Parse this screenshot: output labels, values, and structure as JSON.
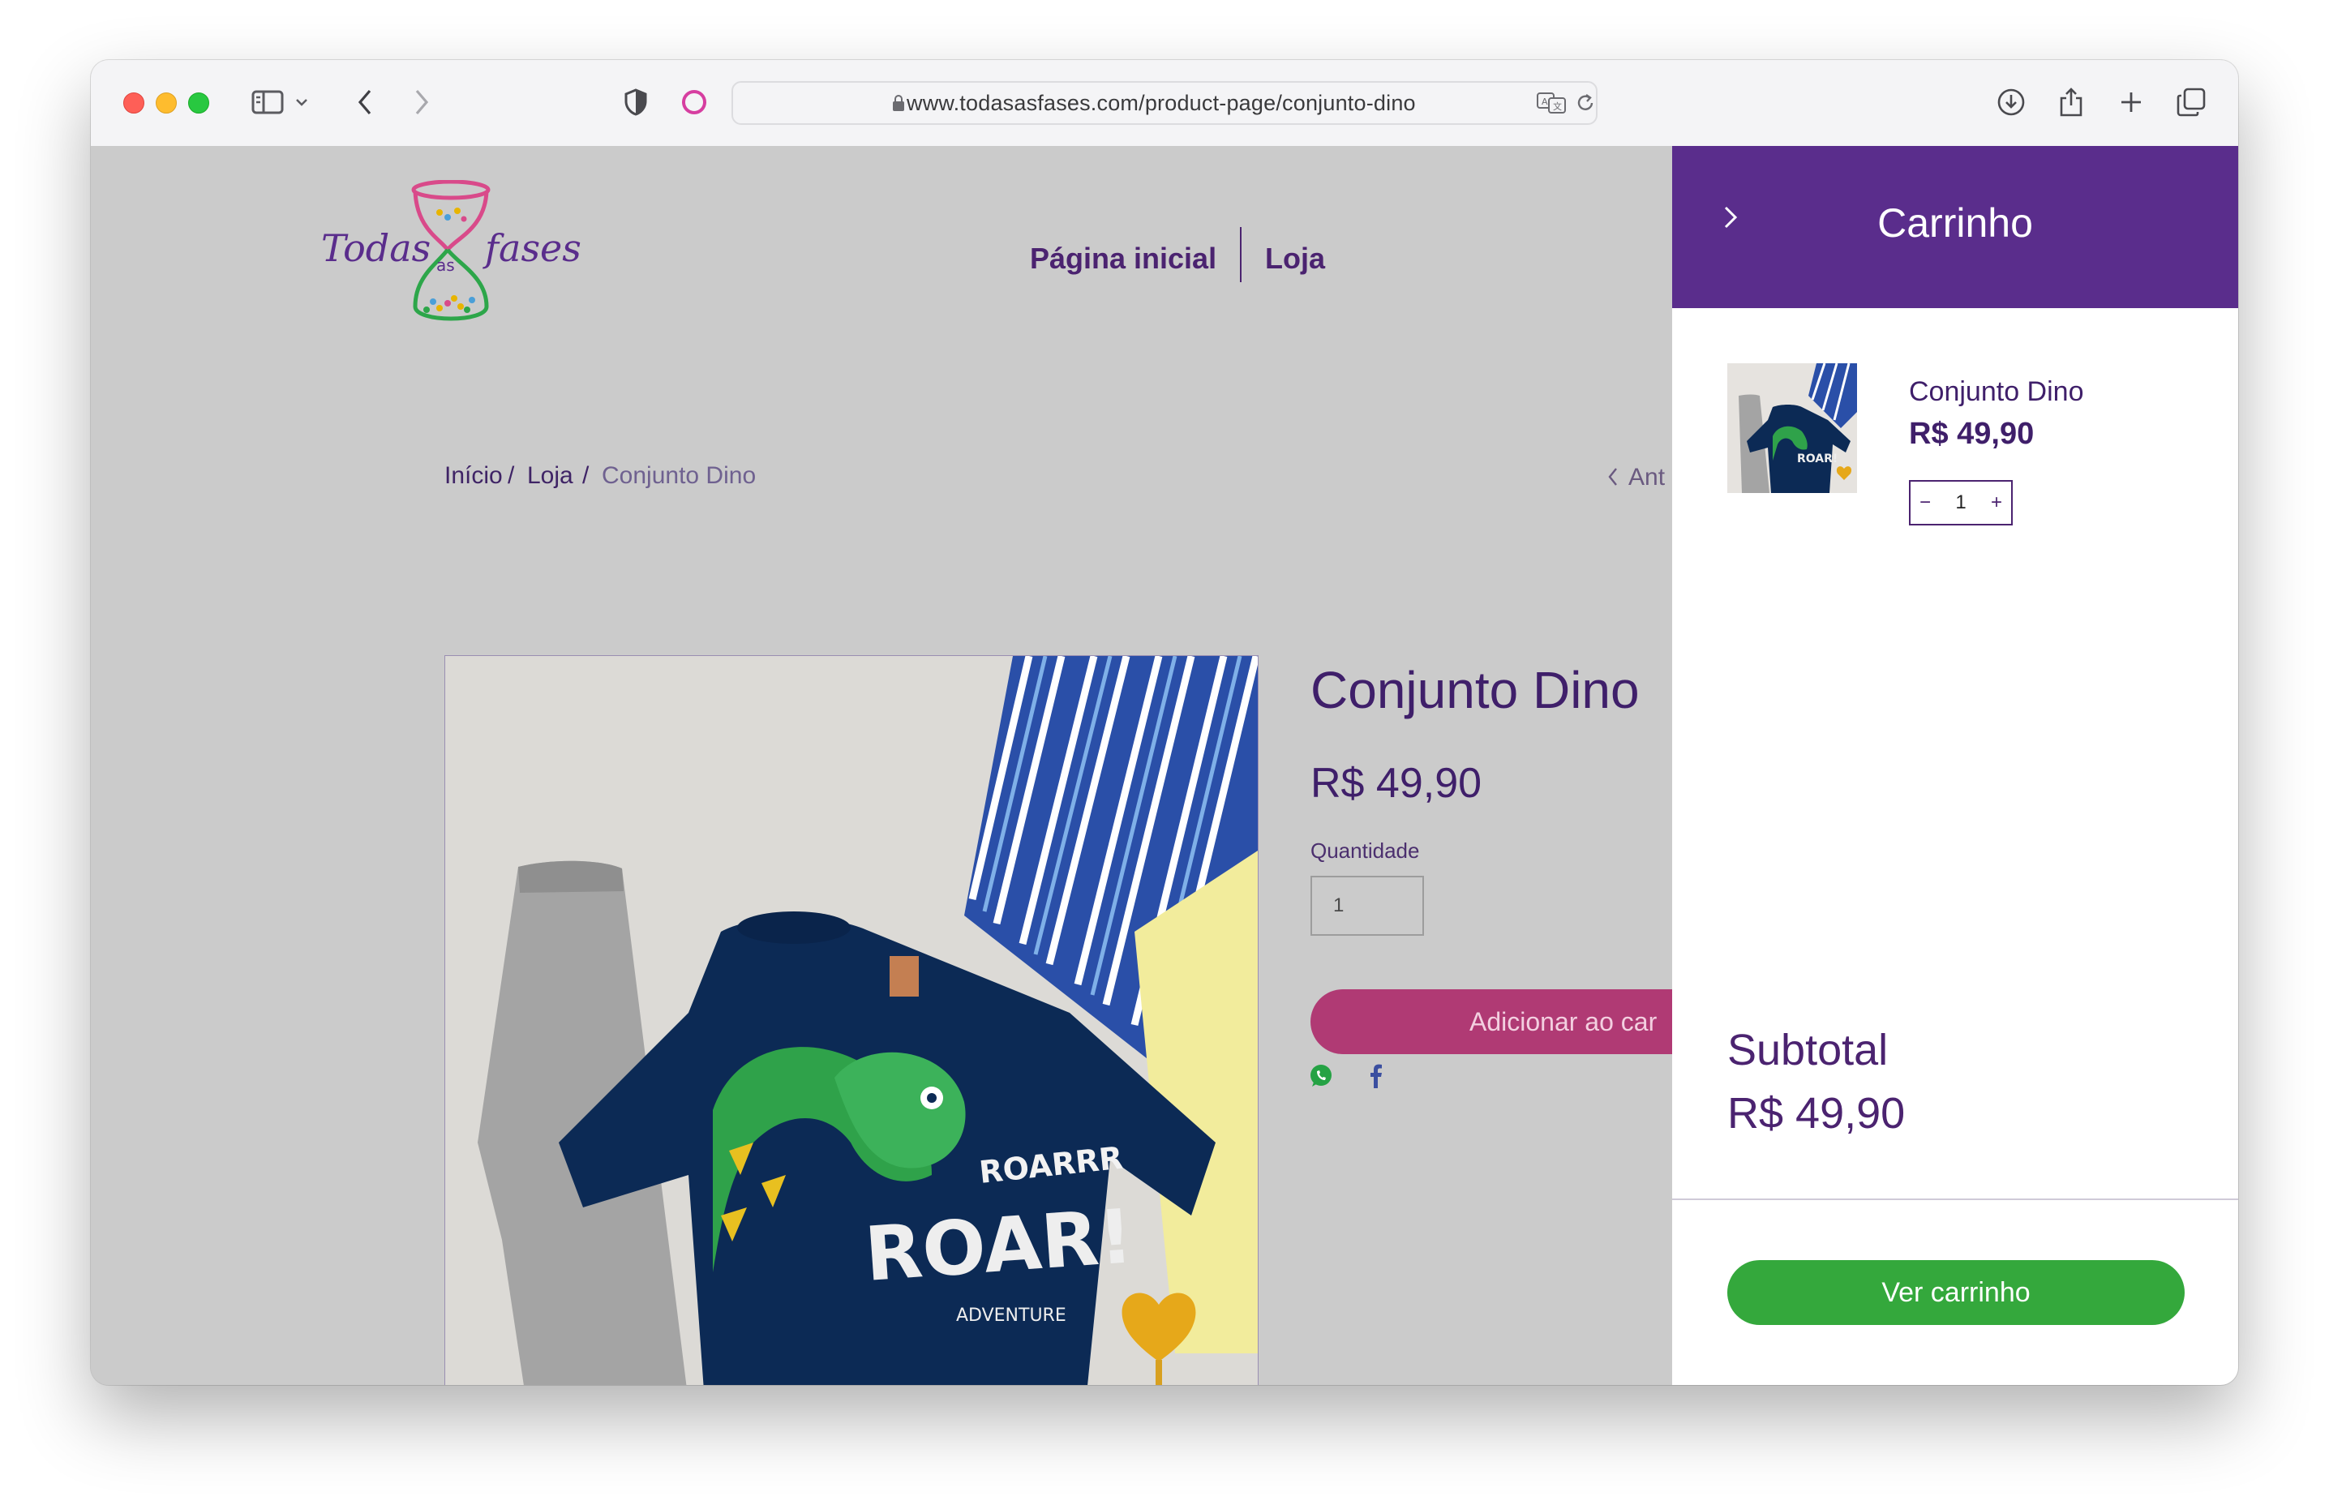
{
  "browser": {
    "url": "www.todasasfases.com/product-page/conjunto-dino"
  },
  "site": {
    "logo_text": "Todas as fases",
    "nav": [
      "Página inicial",
      "Loja"
    ]
  },
  "breadcrumb": {
    "home": "Início",
    "sep1": "/",
    "shop": "Loja",
    "sep2": "/",
    "current": "Conjunto Dino"
  },
  "pager": {
    "prev": "Ant"
  },
  "product": {
    "title": "Conjunto Dino",
    "price": "R$ 49,90",
    "quantity_label": "Quantidade",
    "quantity": "1",
    "add_to_cart": "Adicionar ao car",
    "image_text": [
      "ROARRR",
      "ROAR!",
      "ADVENTURE"
    ]
  },
  "cart": {
    "title": "Carrinho",
    "item": {
      "name": "Conjunto Dino",
      "price": "R$ 49,90",
      "quantity": "1",
      "minus": "−",
      "plus": "+"
    },
    "subtotal_label": "Subtotal",
    "subtotal_value": "R$ 49,90",
    "checkout": "Ver carrinho"
  },
  "colors": {
    "brand_purple": "#5a2d8c",
    "add_button": "#b03a74",
    "checkout_green": "#34a83c"
  },
  "icons": [
    "sidebar-icon",
    "chevron-down-icon",
    "back-icon",
    "forward-icon",
    "shield-icon",
    "extension-icon",
    "lock-icon",
    "translate-icon",
    "reload-icon",
    "download-icon",
    "share-icon",
    "new-tab-icon",
    "tabs-icon",
    "whatsapp-icon",
    "facebook-icon",
    "close-chevron-icon"
  ]
}
